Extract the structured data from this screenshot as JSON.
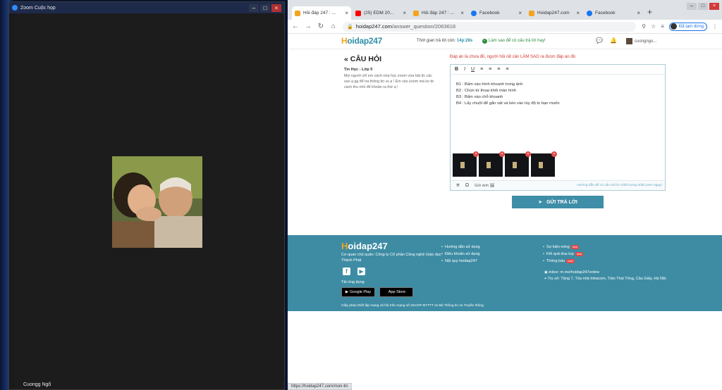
{
  "zoom": {
    "title": "Zoom Cuộc họp",
    "participant_name": "Cuongg Ngô"
  },
  "browser": {
    "tabs": [
      {
        "label": "Hỏi đáp 247 : ...",
        "favicon_color": "#f2a520",
        "active": true
      },
      {
        "label": "(25) EDM 20...",
        "favicon_color": "#ff0000",
        "active": false
      },
      {
        "label": "Hỏi đáp 247 : ...",
        "favicon_color": "#f2a520",
        "active": false
      },
      {
        "label": "Facebook",
        "favicon_color": "#1877f2",
        "active": false
      },
      {
        "label": "Hoidap247.com",
        "favicon_color": "#f2a520",
        "active": false
      },
      {
        "label": "Facebook",
        "favicon_color": "#1877f2",
        "active": false
      }
    ],
    "url_host": "hoidap247.com",
    "url_path": "/answer_question/2063618",
    "profile_label": "Đã tạm dừng",
    "status_url": "https://hoidap247.com/mon-tin"
  },
  "header": {
    "logo_h": "H",
    "logo_rest": "oidap247",
    "timer_label": "Thời gian trả lời còn:",
    "timer_value": "14p:28s",
    "notice": "Làm sao để có câu trả lời hay!",
    "username": "cuongngo..."
  },
  "question": {
    "heading": "« CÂU HỎI",
    "subject": "Tin Học - Lớp 9",
    "text": "Mọi người chỉ em cách vừa học zoom vừa bài đc các sao ạ gg để tra thông tin vs ạ ! Em vào zoom mà ko bt cách thu nhỏ để khoản ra thứ ạ !"
  },
  "answer": {
    "warning": "Đáp án là chưa đủ, người hỏi rất cần LÀM SAO ra được đáp án đó",
    "toolbar": [
      "B",
      "I",
      "U",
      "≡",
      "≡",
      "≡",
      "≡"
    ],
    "lines": [
      "B1 : Bấm vào hình khoanh trong ảnh",
      "B2 : Chọn từ thoại khối màn hình",
      "B3 : Bấm vào chỗ khoanh",
      "B4 : Lấy chuột để gắn sát và kéo vào tùy độ to bạn muốn"
    ],
    "attach_label": "Gửi ảnh",
    "guide_label": "Hướng dẫn để có câu trả lời chất lượng nhất (xem ngay)",
    "submit_label": "GỬI TRẢ LỜI"
  },
  "footer": {
    "owner": "Cơ quan chủ quản: Công ty Cổ phần Công nghệ Giáo dục Thành Phát",
    "download": "Tải ứng dụng",
    "google_play": "Google Play",
    "app_store": "App Store",
    "links": [
      "Hướng dẫn sử dụng",
      "Điều khoản sử dụng",
      "Nội quy hoidap247"
    ],
    "news": [
      {
        "label": "Sự kiện nóng",
        "badge": "new"
      },
      {
        "label": "Kết quả đua top",
        "badge": "new"
      },
      {
        "label": "Thông báo",
        "badge": "new"
      }
    ],
    "inbox": "inbox: m.me/hoidap247online",
    "address": "Trụ sở: Tầng 7, Tòa nhà Intracom, Trần Thái Tông, Cầu Giấy, Hà Nội.",
    "license": "Giấy phép thiết lập mạng xã hội trên mạng số 331/GP-BTTTT do Bộ Thông tin và Truyền thông."
  }
}
